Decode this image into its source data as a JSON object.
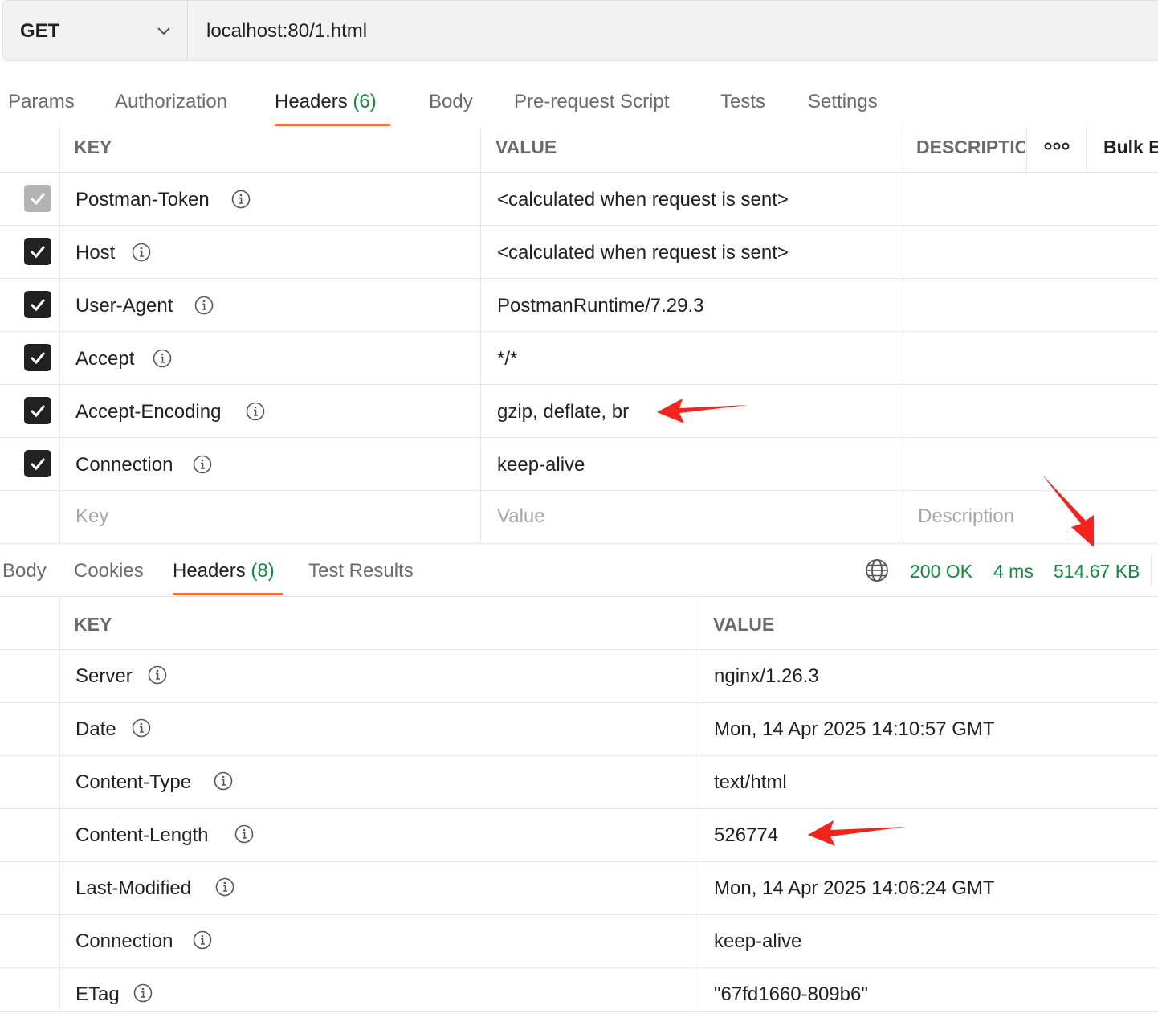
{
  "request": {
    "method": "GET",
    "url": "localhost:80/1.html"
  },
  "request_tabs": {
    "params": "Params",
    "authorization": "Authorization",
    "headers": "Headers",
    "headers_count": "(6)",
    "body": "Body",
    "prerequest": "Pre-request Script",
    "tests": "Tests",
    "settings": "Settings"
  },
  "request_headers": {
    "key_header": "KEY",
    "value_header": "VALUE",
    "description_header": "DESCRIPTIC",
    "more_label": "ooo",
    "bulk_edit": "Bulk E",
    "rows": [
      {
        "key": "Postman-Token",
        "value": "<calculated when request is sent>",
        "checked": true,
        "disabled": true
      },
      {
        "key": "Host",
        "value": "<calculated when request is sent>",
        "checked": true,
        "disabled": false
      },
      {
        "key": "User-Agent",
        "value": "PostmanRuntime/7.29.3",
        "checked": true,
        "disabled": false
      },
      {
        "key": "Accept",
        "value": "*/*",
        "checked": true,
        "disabled": false
      },
      {
        "key": "Accept-Encoding",
        "value": "gzip, deflate, br",
        "checked": true,
        "disabled": false
      },
      {
        "key": "Connection",
        "value": "keep-alive",
        "checked": true,
        "disabled": false
      }
    ],
    "placeholder": {
      "key": "Key",
      "value": "Value",
      "description": "Description"
    }
  },
  "response_tabs": {
    "body": "Body",
    "cookies": "Cookies",
    "headers": "Headers",
    "headers_count": "(8)",
    "test_results": "Test Results"
  },
  "response_status": {
    "status": "200 OK",
    "time": "4 ms",
    "size": "514.67 KB",
    "color": "#0f8c3f"
  },
  "response_headers": {
    "key_header": "KEY",
    "value_header": "VALUE",
    "rows": [
      {
        "key": "Server",
        "value": "nginx/1.26.3"
      },
      {
        "key": "Date",
        "value": "Mon, 14 Apr 2025 14:10:57 GMT"
      },
      {
        "key": "Content-Type",
        "value": "text/html"
      },
      {
        "key": "Content-Length",
        "value": "526774"
      },
      {
        "key": "Last-Modified",
        "value": "Mon, 14 Apr 2025 14:06:24 GMT"
      },
      {
        "key": "Connection",
        "value": "keep-alive"
      },
      {
        "key": "ETag",
        "value": "\"67fd1660-809b6\""
      }
    ]
  },
  "colors": {
    "accent": "#ff6c37",
    "status_green": "#0f8c3f",
    "annotation_arrow": "#f5231b"
  }
}
